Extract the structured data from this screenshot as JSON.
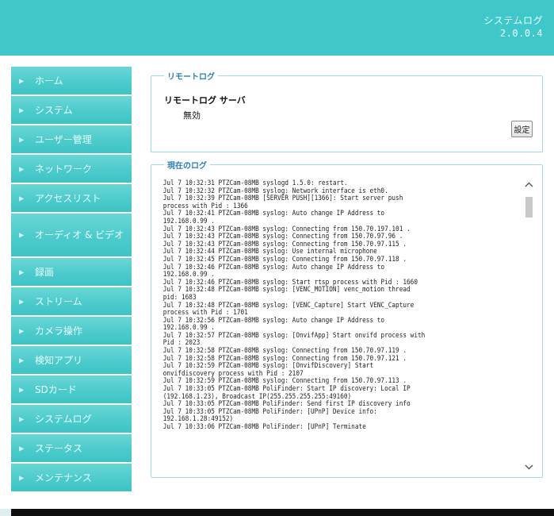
{
  "header": {
    "title_line1": "システムログ",
    "title_line2": "2.0.0.4"
  },
  "sidebar": {
    "items": [
      {
        "label": "ホーム"
      },
      {
        "label": "システム"
      },
      {
        "label": "ユーザー管理"
      },
      {
        "label": "ネットワーク"
      },
      {
        "label": "アクセスリスト"
      },
      {
        "label": "オーディオ & ビデオ"
      },
      {
        "label": "録画"
      },
      {
        "label": "ストリーム"
      },
      {
        "label": "カメラ操作"
      },
      {
        "label": "検知アプリ"
      },
      {
        "label": "SDカード"
      },
      {
        "label": "システムログ"
      },
      {
        "label": "ステータス"
      },
      {
        "label": "メンテナンス"
      }
    ]
  },
  "remote_log": {
    "legend": "リモートログ",
    "server_label": "リモートログ サーバ",
    "server_value": "無効",
    "settings_button": "設定"
  },
  "current_log": {
    "legend": "現在のログ",
    "text": "Jul 7 10:32:31 PTZCam-08MB syslogd 1.5.0: restart.\nJul 7 10:32:32 PTZCam-08MB syslog: Network interface is eth0.\nJul 7 10:32:39 PTZCam-08MB [SERVER PUSH][1366]: Start server push\nprocess with Pid : 1366\nJul 7 10:32:41 PTZCam-08MB syslog: Auto change IP Address to\n192.168.0.99 .\nJul 7 10:32:43 PTZCam-08MB syslog: Connecting from 150.70.197.101 .\nJul 7 10:32:43 PTZCam-08MB syslog: Connecting from 150.70.97.96 .\nJul 7 10:32:43 PTZCam-08MB syslog: Connecting from 150.70.97.115 .\nJul 7 10:32:44 PTZCam-08MB syslog: Use internal microphone\nJul 7 10:32:45 PTZCam-08MB syslog: Connecting from 150.70.97.118 .\nJul 7 10:32:46 PTZCam-08MB syslog: Auto change IP Address to\n192.168.0.99 .\nJul 7 10:32:46 PTZCam-08MB syslog: Start rtsp process with Pid : 1660\nJul 7 10:32:48 PTZCam-08MB syslog: [VENC_MOTION] venc_motion thread\npid: 1683\nJul 7 10:32:48 PTZCam-08MB syslog: [VENC_Capture] Start VENC_Capture\nprocess with Pid : 1701\nJul 7 10:32:56 PTZCam-08MB syslog: Auto change IP Address to\n192.168.0.99 .\nJul 7 10:32:57 PTZCam-08MB syslog: [OnvifApp] Start onvifd process with\nPid : 2023\nJul 7 10:32:58 PTZCam-08MB syslog: Connecting from 150.70.97.119 .\nJul 7 10:32:58 PTZCam-08MB syslog: Connecting from 150.70.97.121 .\nJul 7 10:32:59 PTZCam-08MB syslog: [OnvifDiscovery] Start\nonvifdiscovery process with Pid : 2107\nJul 7 10:32:59 PTZCam-08MB syslog: Connecting from 150.70.97.113 .\nJul 7 10:33:05 PTZCam-08MB PoliFinder: Start IP discovery: Local IP\n(192.168.1.23), Broadcast IP(255.255.255.255:49160)\nJul 7 10:33:05 PTZCam-08MB PoliFinder: Send first IP discovery info\nJul 7 10:33:05 PTZCam-08MB PoliFinder: [UPnP] Device info:\n192.168.1.28:49152)\nJul 7 10:33:06 PTZCam-08MB PoliFinder: [UPnP] Terminate"
  }
}
